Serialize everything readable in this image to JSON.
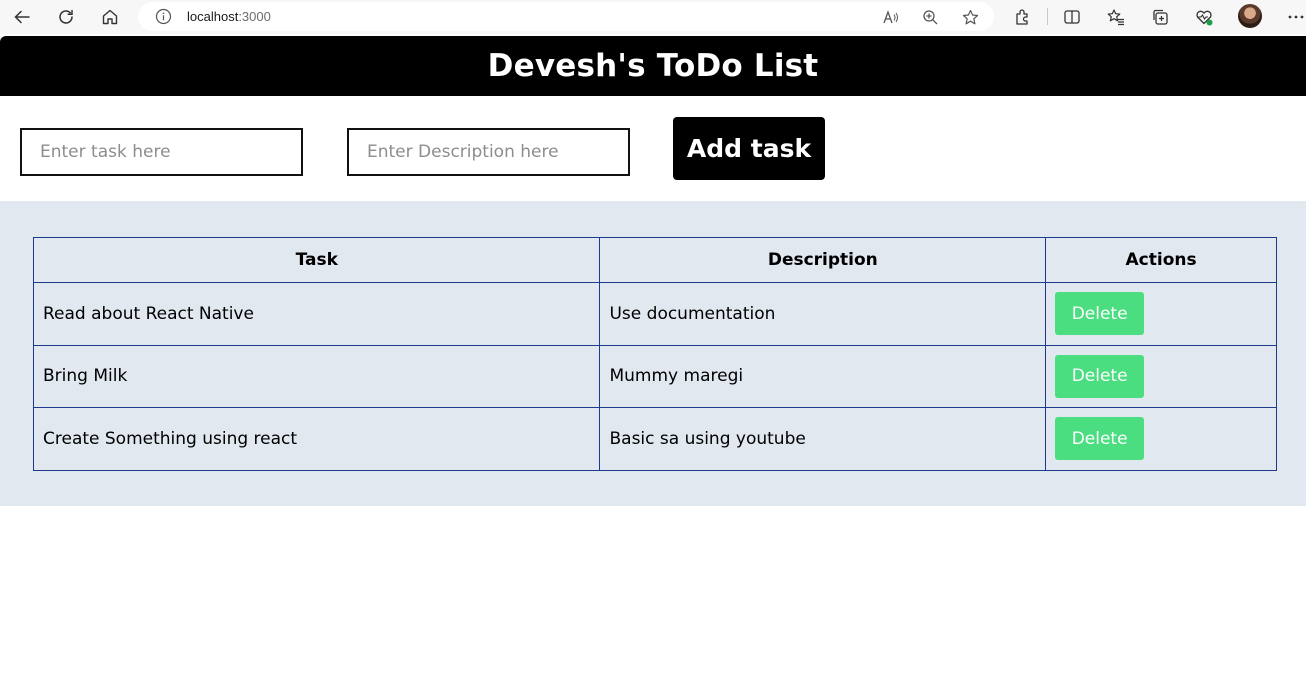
{
  "browser": {
    "url_host": "localhost",
    "url_port": ":3000",
    "icons": [
      "back-icon",
      "refresh-icon",
      "home-icon",
      "info-icon",
      "read-aloud-icon",
      "zoom-icon",
      "favorite-star-icon",
      "extensions-icon",
      "split-screen-icon",
      "favorites-icon",
      "collections-icon",
      "browser-essentials-icon",
      "profile-avatar",
      "more-menu-icon"
    ]
  },
  "app": {
    "title": "Devesh's ToDo List"
  },
  "form": {
    "task_placeholder": "Enter task here",
    "task_value": "",
    "description_placeholder": "Enter Description here",
    "description_value": "",
    "add_button_label": "Add task"
  },
  "table": {
    "headers": [
      "Task",
      "Description",
      "Actions"
    ],
    "rows": [
      {
        "task": "Read about React Native",
        "description": "Use documentation",
        "action_label": "Delete"
      },
      {
        "task": "Bring Milk",
        "description": "Mummy maregi",
        "action_label": "Delete"
      },
      {
        "task": "Create Something using react",
        "description": "Basic sa using youtube",
        "action_label": "Delete"
      }
    ]
  },
  "colors": {
    "header_bg": "#000000",
    "table_section_bg": "#e2e8f0",
    "table_border": "#1e3a8a",
    "delete_button": "#4ade80"
  }
}
